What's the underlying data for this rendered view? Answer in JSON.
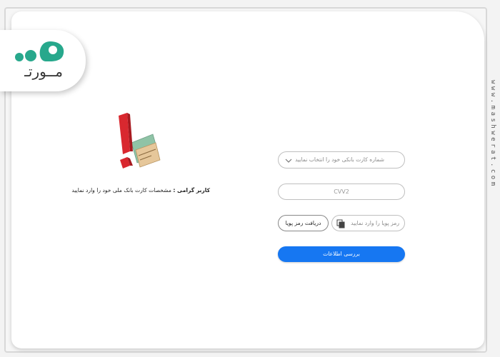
{
  "brand": {
    "logo_text": "مـ‌ـورتـ",
    "site": "www.mashwerat.com"
  },
  "notice": {
    "label": "کاربر گرامی :",
    "text": "مشخصات کارت بانک ملی خود را وارد نمایید"
  },
  "form": {
    "card_select_placeholder": "شماره کارت بانکی خود را انتخاب نمایید",
    "cvv2_placeholder": "CVV2",
    "otp_placeholder": "رمز پویا را وارد نمایید",
    "otp_button": "دریافت رمز پویا",
    "submit_button": "بررسی اطلاعات"
  },
  "colors": {
    "accent": "#1677f2",
    "logo_teal": "#27a88c",
    "warning_red": "#d9282f"
  },
  "icons": [
    "logo-icon",
    "warning-illustration",
    "chevron-down-icon",
    "copy-icon"
  ]
}
